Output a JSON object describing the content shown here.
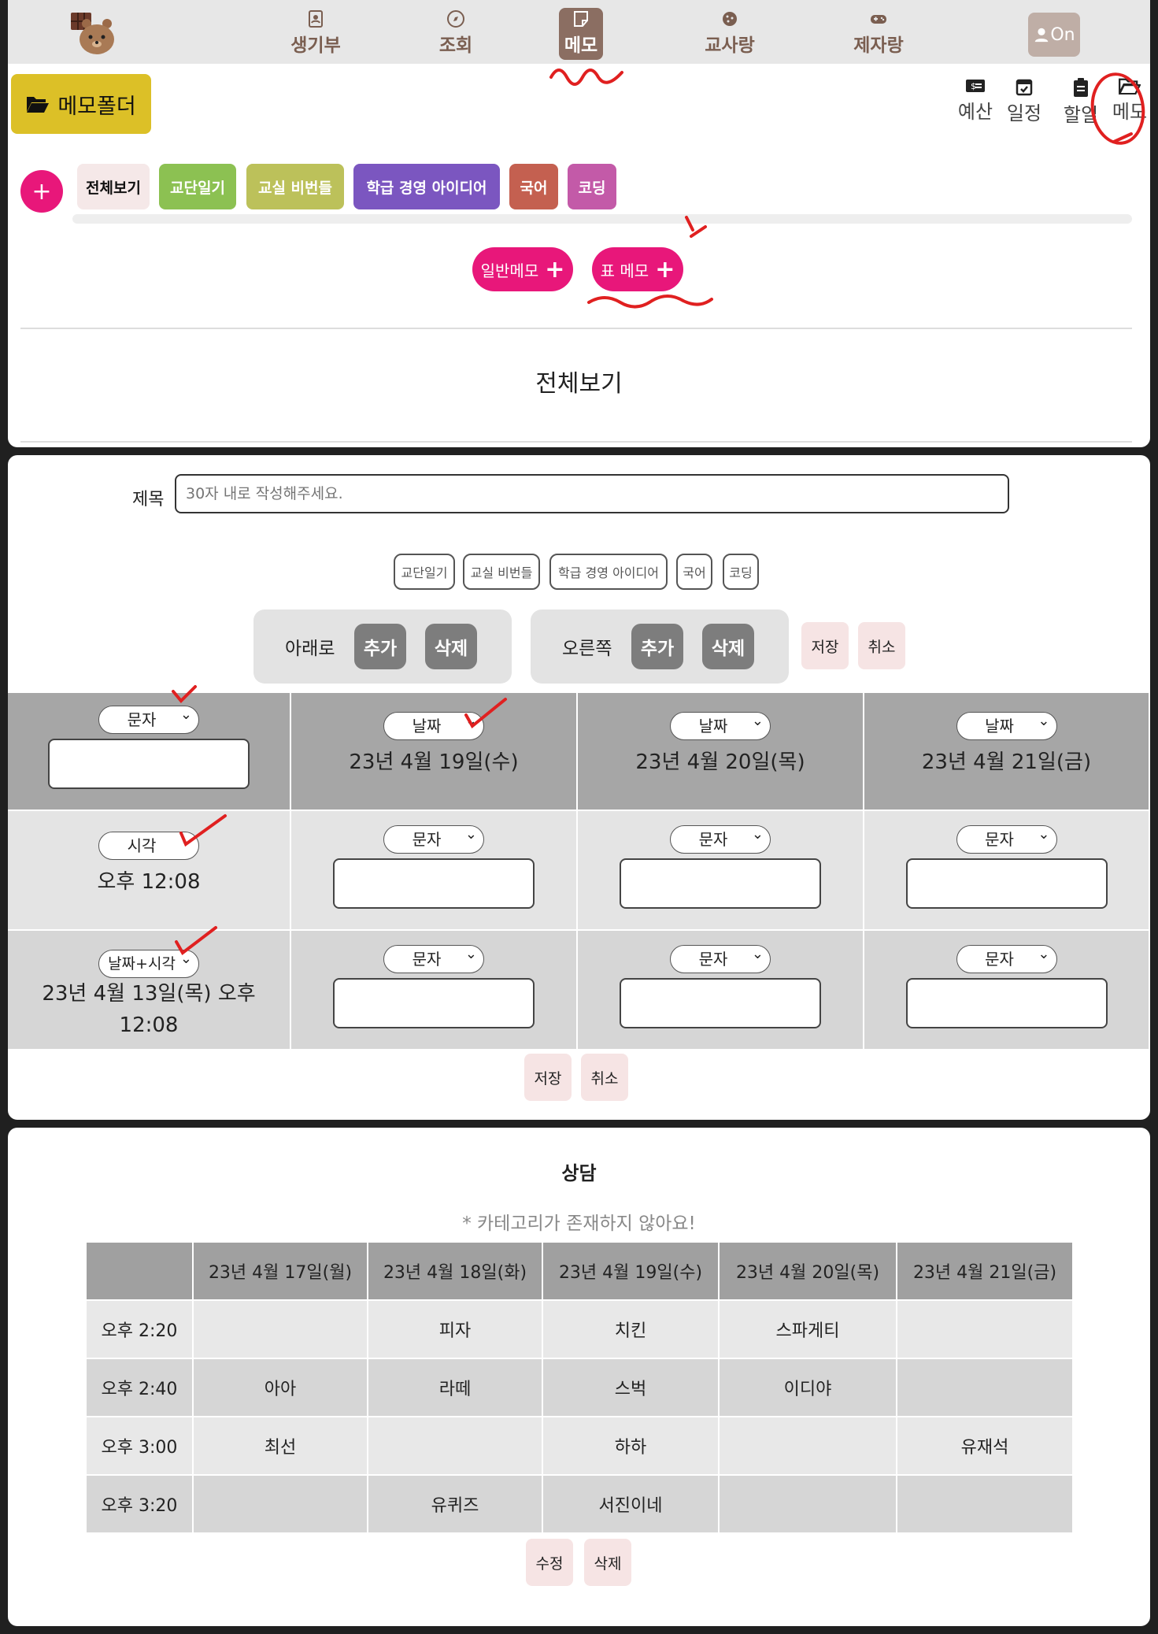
{
  "nav": {
    "items": [
      {
        "label": "생기부",
        "icon": "contacts-icon"
      },
      {
        "label": "조회",
        "icon": "compass-icon"
      },
      {
        "label": "메모",
        "icon": "note-icon",
        "active": true
      },
      {
        "label": "교사랑",
        "icon": "cookie-icon"
      },
      {
        "label": "제자랑",
        "icon": "gamepad-icon"
      }
    ],
    "profile_label": "On"
  },
  "toolbar": {
    "folder_label": "메모폴더",
    "side_links": [
      "예산",
      "일정",
      "할일",
      "메모"
    ]
  },
  "categories": [
    {
      "label": "전체보기",
      "color": "#f5e8e8",
      "text": "#111"
    },
    {
      "label": "교단일기",
      "color": "#8cc152",
      "text": "#fff"
    },
    {
      "label": "교실 비번들",
      "color": "#bcc15a",
      "text": "#fff"
    },
    {
      "label": "학급 경영 아이디어",
      "color": "#7b56c0",
      "text": "#fff"
    },
    {
      "label": "국어",
      "color": "#c46050",
      "text": "#fff"
    },
    {
      "label": "코딩",
      "color": "#c35aa8",
      "text": "#fff"
    }
  ],
  "memo_buttons": {
    "general": "일반메모",
    "table": "표 메모"
  },
  "section_title": "전체보기",
  "form": {
    "title_label": "제목",
    "title_placeholder": "30자 내로 작성해주세요.",
    "category_buttons": [
      "교단일기",
      "교실 비번들",
      "학급 경영 아이디어",
      "국어",
      "코딩"
    ],
    "down_label": "아래로",
    "right_label": "오른쪽",
    "add_label": "추가",
    "delete_label": "삭제",
    "save_label": "저장",
    "cancel_label": "취소"
  },
  "grid": {
    "row1": [
      {
        "type": "문자",
        "value": ""
      },
      {
        "type": "날짜",
        "text": "23년 4월 19일(수)"
      },
      {
        "type": "날짜",
        "text": "23년 4월 20일(목)"
      },
      {
        "type": "날짜",
        "text": "23년 4월 21일(금)"
      }
    ],
    "row2": [
      {
        "type": "시각",
        "text": "오후 12:08"
      },
      {
        "type": "문자"
      },
      {
        "type": "문자"
      },
      {
        "type": "문자"
      }
    ],
    "row3": [
      {
        "type": "날짜+시각",
        "text": "23년 4월 13일(목) 오후 12:08"
      },
      {
        "type": "문자"
      },
      {
        "type": "문자"
      },
      {
        "type": "문자"
      }
    ]
  },
  "consult": {
    "title": "상담",
    "notice": "* 카테고리가 존재하지 않아요!",
    "headers": [
      "",
      "23년 4월 17일(월)",
      "23년 4월 18일(화)",
      "23년 4월 19일(수)",
      "23년 4월 20일(목)",
      "23년 4월 21일(금)"
    ],
    "rows": [
      [
        "오후 2:20",
        "",
        "피자",
        "치킨",
        "스파게티",
        ""
      ],
      [
        "오후 2:40",
        "아아",
        "라떼",
        "스벅",
        "이디야",
        ""
      ],
      [
        "오후 3:00",
        "최선",
        "",
        "하하",
        "",
        "유재석"
      ],
      [
        "오후 3:20",
        "",
        "유퀴즈",
        "서진이네",
        "",
        ""
      ]
    ],
    "edit_label": "수정",
    "delete_label": "삭제"
  },
  "colors": {
    "accent_pink": "#e8177a",
    "folder_yellow": "#dcc027",
    "nav_active": "#8b6e62",
    "annotation_red": "#e02020"
  }
}
